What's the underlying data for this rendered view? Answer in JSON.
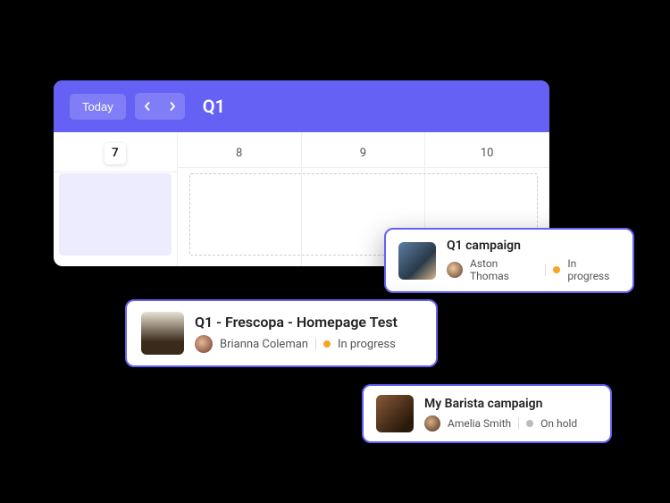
{
  "header": {
    "today_label": "Today",
    "title": "Q1"
  },
  "days": [
    {
      "num": "7",
      "selected": true
    },
    {
      "num": "8",
      "selected": false
    },
    {
      "num": "9",
      "selected": false
    },
    {
      "num": "10",
      "selected": false
    }
  ],
  "cards": [
    {
      "title": "Q1 campaign",
      "owner": "Aston Thomas",
      "status_label": "In progress",
      "status": "progress",
      "thumb": "landscape-photo",
      "avatar": "person-1"
    },
    {
      "title": "Q1 - Frescopa - Homepage Test",
      "owner": "Brianna Coleman",
      "status_label": "In progress",
      "status": "progress",
      "thumb": "espresso-photo",
      "avatar": "person-2"
    },
    {
      "title": "My Barista campaign",
      "owner": "Amelia Smith",
      "status_label": "On hold",
      "status": "hold",
      "thumb": "barista-tools-photo",
      "avatar": "person-3"
    }
  ],
  "colors": {
    "primary": "#6561f5",
    "status_in_progress": "#f5a623",
    "status_on_hold": "#bbbbbb"
  }
}
